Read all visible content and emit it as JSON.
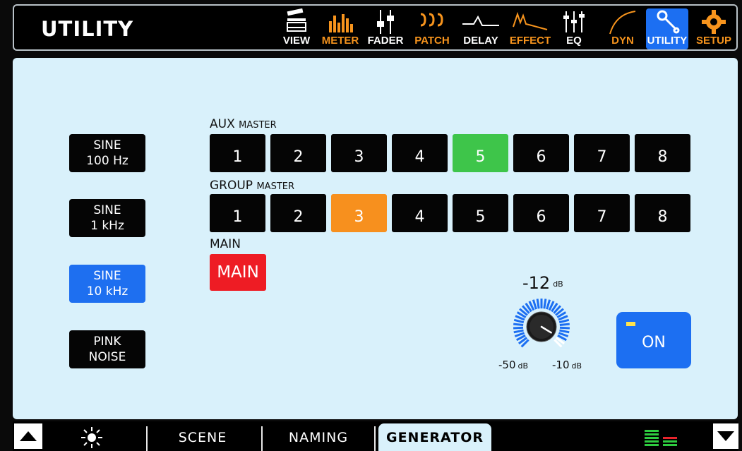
{
  "header": {
    "title": "UTILITY",
    "nav": [
      {
        "label": "VIEW",
        "icon": "view-icon",
        "color": "white"
      },
      {
        "label": "METER",
        "icon": "meter-icon",
        "color": "orange"
      },
      {
        "label": "FADER",
        "icon": "fader-icon",
        "color": "white"
      },
      {
        "label": "PATCH",
        "icon": "patch-icon",
        "color": "orange"
      },
      {
        "label": "DELAY",
        "icon": "delay-icon",
        "color": "white"
      },
      {
        "label": "EFFECT",
        "icon": "effect-icon",
        "color": "orange"
      },
      {
        "label": "EQ",
        "icon": "eq-icon",
        "color": "white"
      },
      {
        "label": "DYN",
        "icon": "dyn-icon",
        "color": "orange"
      },
      {
        "label": "UTILITY",
        "icon": "utility-wrench-icon",
        "color": "white",
        "active": true
      },
      {
        "label": "SETUP",
        "icon": "setup-gear-icon",
        "color": "orange"
      }
    ]
  },
  "generator": {
    "sources": [
      {
        "line1": "SINE",
        "line2": "100 Hz",
        "active": false
      },
      {
        "line1": "SINE",
        "line2": "1 kHz",
        "active": false
      },
      {
        "line1": "SINE",
        "line2": "10 kHz",
        "active": true
      },
      {
        "line1": "PINK",
        "line2": "NOISE",
        "active": false
      }
    ],
    "aux_label": "AUX",
    "aux_sublabel": "MASTER",
    "aux_buses": [
      "1",
      "2",
      "3",
      "4",
      "5",
      "6",
      "7",
      "8"
    ],
    "aux_selected": "5",
    "group_label": "GROUP",
    "group_sublabel": "MASTER",
    "group_buses": [
      "1",
      "2",
      "3",
      "4",
      "5",
      "6",
      "7",
      "8"
    ],
    "group_selected": "3",
    "main_label": "MAIN",
    "main_button": "MAIN",
    "level_value": "-12",
    "level_unit": "dB",
    "knob_fraction": 0.95,
    "knob_min": "-50",
    "knob_max": "-10",
    "knob_unit": "dB",
    "on_label": "ON"
  },
  "footer": {
    "brightness_icon": "sun-icon",
    "tabs": [
      "SCENE",
      "NAMING",
      "GENERATOR"
    ],
    "active_tab": "GENERATOR",
    "meter_icon": "level-meter-icon"
  },
  "colors": {
    "panel_bg": "#d9f1fb",
    "accent_blue": "#1c6ff2",
    "aux_selected": "#3ec54a",
    "group_selected": "#f7901e",
    "main": "#ee1c24",
    "nav_orange": "#f7941d"
  }
}
